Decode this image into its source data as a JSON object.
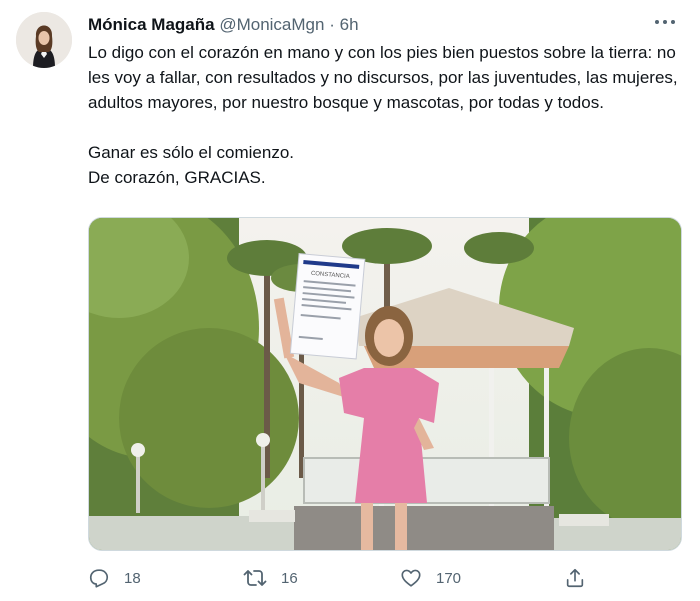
{
  "tweet": {
    "author_name": "Mónica Magaña",
    "handle": "@MonicaMgn",
    "separator": "·",
    "time": "6h",
    "text": "Lo digo con el corazón en mano y con los pies bien puestos sobre la tierra: no les voy a fallar, con resultados y no discursos, por las juventudes, las mujeres, adultos mayores, por nuestro bosque y mascotas, por todas y todos.\n\nGanar es sólo el comienzo.\nDe corazón, GRACIAS.",
    "media": {
      "document_heading": "CONSTANCIA"
    }
  },
  "actions": {
    "reply_count": "18",
    "retweet_count": "16",
    "like_count": "170"
  },
  "icons": {
    "more": "more-horizontal-icon",
    "reply": "reply-icon",
    "retweet": "retweet-icon",
    "like": "heart-icon",
    "share": "share-icon"
  },
  "colors": {
    "text": "#0f1419",
    "secondary": "#536471",
    "dress": "#e57ea8"
  }
}
